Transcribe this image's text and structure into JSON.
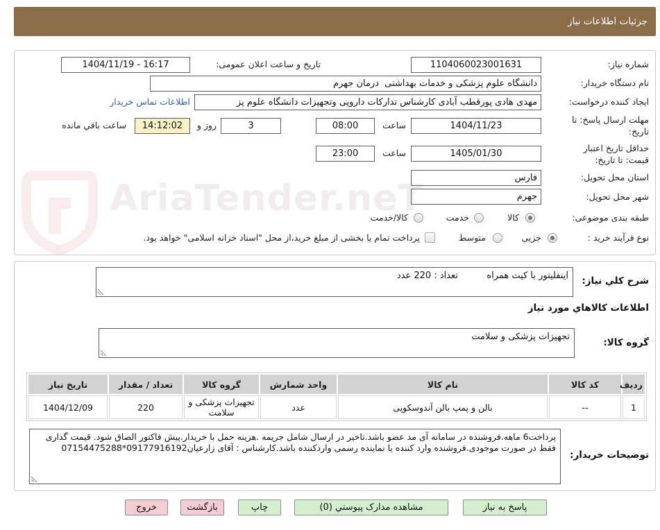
{
  "colors": {
    "header_bg": "#8b6e49",
    "link": "#2b5fb3",
    "remaining_bg": "#f6f2c6",
    "button_green": "#d4efcd",
    "button_pink": "#f6cdd5",
    "table_header_bg": "#d2d2d2"
  },
  "header": {
    "title": "جزئیات اطلاعات نیاز"
  },
  "watermark": "AriaTender.neT",
  "details": {
    "need_number": {
      "label": "شماره نیاز:",
      "value": "1104060023001631"
    },
    "announce": {
      "label": "تاریخ و ساعت اعلان عمومی:",
      "value": "1404/11/19 - 16:17"
    },
    "buyer_org": {
      "label": "نام دستگاه خریدار:",
      "value": "دانشگاه علوم پزشکی و خدمات بهداشتی  درمان جهرم"
    },
    "requester": {
      "label": "ایجاد کننده درخواست:",
      "value": "مهدی هادی پورقطب آبادی کارشناس تدارکات دارویی وتجهیزات دانشگاه علوم پز",
      "contact_link": "اطلاعات تماس خریدار"
    },
    "deadline": {
      "label_line1": "مهلت ارسال پاسخ: تا",
      "label_line2": "تاریخ:",
      "date": "1404/11/23",
      "time_label": "ساعت",
      "time": "08:00",
      "days": "3",
      "days_label": "روز و",
      "remaining": "14:12:02",
      "remaining_label": "ساعت باقي مانده"
    },
    "price_validity": {
      "label_line1": "حداقل تاریخ اعتبار",
      "label_line2": "قیمت: تا تاریخ:",
      "date": "1405/01/30",
      "time_label": "ساعت",
      "time": "23:00"
    },
    "province": {
      "label": "استان محل تحویل:",
      "value": "فارس"
    },
    "city": {
      "label": "شهر محل تحویل:",
      "value": "جهرم"
    },
    "category": {
      "label": "طبقه بندی موضوعی:",
      "options": [
        "کالا",
        "خدمت",
        "کالا/خدمت"
      ],
      "selected": 0
    },
    "purchase_type": {
      "label": "نوع فرآیند خرید :",
      "options": [
        "جزیی",
        "متوسط"
      ],
      "selected": 0,
      "treasury_label": "پرداخت تمام یا بخشی از مبلغ خرید،از محل \"اسناد خزانه اسلامی\" خواهد بود.",
      "treasury_checked": false
    }
  },
  "need": {
    "label": "شرح کلي نیاز:",
    "description": "اینفلیتور با کیت همراه          تعداد : 220 عدد"
  },
  "goods": {
    "section_title": "اطلاعات کالاهاي مورد نیاز",
    "group_label": "گروه کالا:",
    "group_value": "تجهیزات پزشکی و سلامت",
    "table": {
      "headers": [
        "ردیف",
        "کد کالا",
        "نام کالا",
        "واحد شمارش",
        "گروه کالا",
        "تعداد / مقدار",
        "تاریخ نیاز"
      ],
      "rows": [
        [
          "1",
          "--",
          "بالن و پمپ بالن آندوسکوپی",
          "عدد",
          "تجهیزات پزشکی و سلامت",
          "220",
          "1404/12/09"
        ]
      ]
    }
  },
  "notes": {
    "label": "توضیحات خریدار:",
    "text": "پرداخت6 ماهه.فروشنده در سامانه آی مد عضو باشد.تاخیر در ارسال شامل جریمه .هزینه حمل با خریدار.پیش فاکتور الصاق شود. قیمت گذاری فقط در صورت موجودی.فروشنده وارد کننده یا نماینده رسمی واردکننده باشد.کارشناس : آقای زارعیان09177916192*07154475288"
  },
  "buttons": {
    "respond": "پاسخ به نیاز",
    "attachments": "مشاهده مدارک پیوستي (0)",
    "print": "چاپ",
    "back": "بازگشت",
    "exit": "خروج"
  }
}
